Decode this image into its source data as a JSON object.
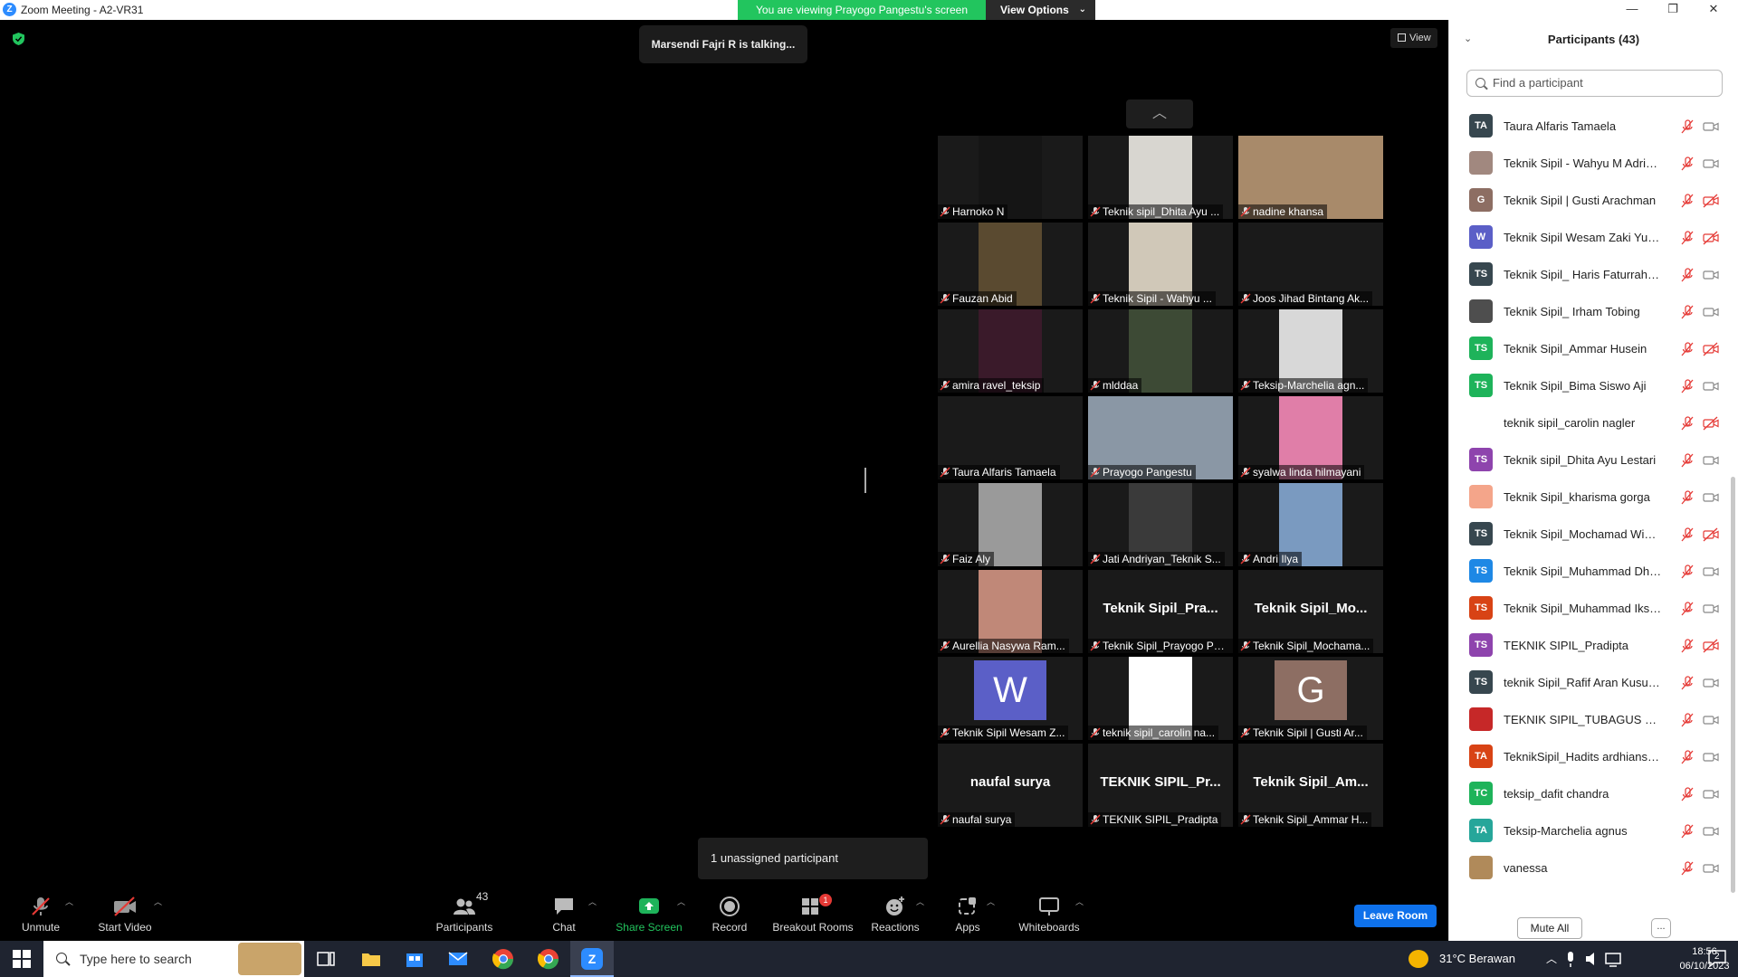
{
  "window": {
    "title": "Zoom Meeting - A2-VR31",
    "viewing_banner": "You are viewing Prayogo Pangestu's screen",
    "view_options": "View Options"
  },
  "meeting": {
    "talking": "Marsendi Fajri R is talking...",
    "view_label": "View",
    "unassigned": "1 unassigned participant"
  },
  "tiles": [
    {
      "label": "Harnoko N",
      "video": "#151515"
    },
    {
      "label": "Teknik sipil_Dhita Ayu ...",
      "video": "#d8d6d0"
    },
    {
      "label": "nadine khansa",
      "video": "#a88a6a"
    },
    {
      "label": "Fauzan Abid",
      "video": "#5a4a30"
    },
    {
      "label": "Teknik Sipil - Wahyu ...",
      "video": "#d0c8b8"
    },
    {
      "label": "Joos Jihad Bintang Ak...",
      "video": ""
    },
    {
      "label": "amira ravel_teksip",
      "video": "#3a1a2a"
    },
    {
      "label": "mlddaa",
      "video": "#3d4a35"
    },
    {
      "label": "Teksip-Marchelia agn...",
      "video": "#d8d8d8"
    },
    {
      "label": "Taura Alfaris Tamaela",
      "video": "#1a1a1a"
    },
    {
      "label": "Prayogo Pangestu",
      "video": "#8a97a5"
    },
    {
      "label": "syalwa linda hilmayani",
      "video": "#e07ea8"
    },
    {
      "label": "Faiz Aly",
      "video": "#9a9a9a"
    },
    {
      "label": "Jati Andriyan_Teknik S...",
      "video": "#3a3a3a"
    },
    {
      "label": "Andri Ilya",
      "video": "#7a9ac0"
    },
    {
      "label": "Aurellia Nasywa Ram...",
      "video": "#c08878"
    },
    {
      "label": "Teknik Sipil_Prayogo Pan...",
      "bigname": "Teknik  Sipil_Pra..."
    },
    {
      "label": "Teknik Sipil_Mochama...",
      "bigname": "Teknik  Sipil_Mo..."
    },
    {
      "label": "Teknik Sipil Wesam Z...",
      "avatar": "W",
      "avatar_color": "#5b5fc7"
    },
    {
      "label": "teknik sipil_carolin na...",
      "video": "#ffffff"
    },
    {
      "label": "Teknik Sipil | Gusti Ar...",
      "avatar": "G",
      "avatar_color": "#8d6e63"
    },
    {
      "label": "naufal surya",
      "bigname": "naufal surya"
    },
    {
      "label": "TEKNIK SIPIL_Pradipta",
      "bigname": "TEKNIK  SIPIL_Pr..."
    },
    {
      "label": "Teknik Sipil_Ammar H...",
      "bigname": "Teknik  Sipil_Am..."
    }
  ],
  "toolbar": {
    "unmute": "Unmute",
    "start_video": "Start Video",
    "participants": "Participants",
    "participants_count": "43",
    "chat": "Chat",
    "share_screen": "Share Screen",
    "record": "Record",
    "breakout_rooms": "Breakout Rooms",
    "breakout_badge": "1",
    "reactions": "Reactions",
    "apps": "Apps",
    "whiteboards": "Whiteboards",
    "leave_room": "Leave Room"
  },
  "panel": {
    "title": "Participants (43)",
    "search_placeholder": "Find a participant",
    "mute_all": "Mute All",
    "more": "...",
    "participants": [
      {
        "initials": "TA",
        "color": "#37474f",
        "name": "Taura Alfaris Tamaela",
        "cam_off": false
      },
      {
        "initials": "",
        "color": "#a1887f",
        "name": "Teknik Sipil - Wahyu M Adrians...",
        "cam_off": false
      },
      {
        "initials": "G",
        "color": "#8d6e63",
        "name": "Teknik Sipil | Gusti Arachman",
        "cam_off": true
      },
      {
        "initials": "W",
        "color": "#5b5fc7",
        "name": "Teknik Sipil Wesam Zaki Yusuf S...",
        "cam_off": true
      },
      {
        "initials": "TS",
        "color": "#37474f",
        "name": "Teknik Sipil_ Haris Faturrahman...",
        "cam_off": false
      },
      {
        "initials": "",
        "color": "#4e4e4e",
        "name": "Teknik Sipil_ Irham Tobing",
        "cam_off": false
      },
      {
        "initials": "TS",
        "color": "#1eb35a",
        "name": "Teknik Sipil_Ammar Husein",
        "cam_off": true
      },
      {
        "initials": "TS",
        "color": "#1eb35a",
        "name": "Teknik Sipil_Bima Siswo Aji",
        "cam_off": false
      },
      {
        "initials": "",
        "color": "#ffffff",
        "name": "teknik sipil_carolin nagler",
        "cam_off": true
      },
      {
        "initials": "TS",
        "color": "#8e44ad",
        "name": "Teknik sipil_Dhita Ayu Lestari",
        "cam_off": false
      },
      {
        "initials": "",
        "color": "#f4a58a",
        "name": "Teknik Sipil_kharisma gorga",
        "cam_off": false
      },
      {
        "initials": "TS",
        "color": "#37474f",
        "name": "Teknik Sipil_Mochamad Windu ...",
        "cam_off": true
      },
      {
        "initials": "TS",
        "color": "#1e88e5",
        "name": "Teknik Sipil_Muhammad Dhafa ...",
        "cam_off": false
      },
      {
        "initials": "TS",
        "color": "#d84315",
        "name": "Teknik Sipil_Muhammad Iksan ...",
        "cam_off": false
      },
      {
        "initials": "TS",
        "color": "#8e44ad",
        "name": "TEKNIK SIPIL_Pradipta",
        "cam_off": true
      },
      {
        "initials": "TS",
        "color": "#37474f",
        "name": "teknik Sipil_Rafif Aran Kusumo",
        "cam_off": false
      },
      {
        "initials": "",
        "color": "#c62828",
        "name": "TEKNIK SIPIL_TUBAGUS M YUS...",
        "cam_off": false
      },
      {
        "initials": "TA",
        "color": "#d84315",
        "name": "TeknikSipil_Hadits ardhiansyah",
        "cam_off": false
      },
      {
        "initials": "TC",
        "color": "#1eb35a",
        "name": "teksip_dafit chandra",
        "cam_off": false
      },
      {
        "initials": "TA",
        "color": "#26a69a",
        "name": "Teksip-Marchelia agnus",
        "cam_off": false
      },
      {
        "initials": "",
        "color": "#b08a5a",
        "name": "vanessa",
        "cam_off": false
      }
    ]
  },
  "taskbar": {
    "search_placeholder": "Type here to search",
    "weather": "31°C  Berawan",
    "time": "18:56",
    "date": "06/10/2023",
    "notif_count": "2"
  }
}
